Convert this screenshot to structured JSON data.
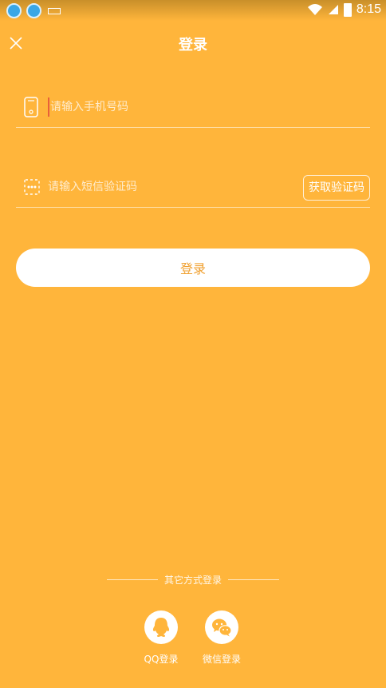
{
  "status_bar": {
    "time": "8:15"
  },
  "header": {
    "title": "登录"
  },
  "phone_field": {
    "placeholder": "请输入手机号码"
  },
  "code_field": {
    "placeholder": "请输入短信验证码",
    "get_code_label": "获取验证码"
  },
  "login_button": {
    "label": "登录"
  },
  "other_login": {
    "label": "其它方式登录",
    "options": [
      {
        "label": "QQ登录",
        "icon": "qq-icon"
      },
      {
        "label": "微信登录",
        "icon": "wechat-icon"
      }
    ]
  },
  "colors": {
    "background": "#FFB53B",
    "button_text": "#F0A030",
    "cursor": "#E85A2A"
  }
}
